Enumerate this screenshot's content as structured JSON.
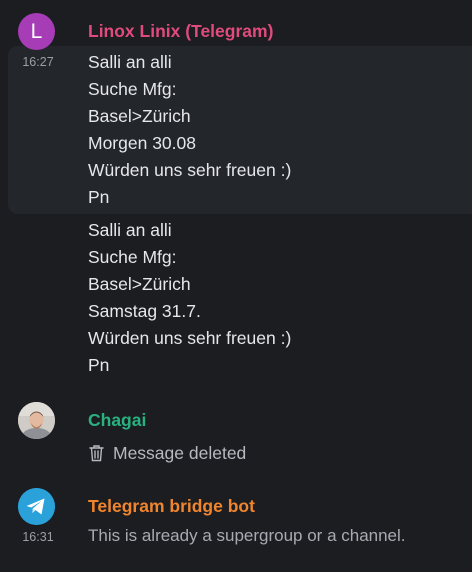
{
  "events": [
    {
      "sender": "Linox Linix (Telegram)",
      "sender_color": "#e14a7d",
      "avatar_letter": "L",
      "avatar_color": "#a63db6",
      "messages": [
        {
          "time": "16:27",
          "lines": [
            "Salli an alli",
            "Suche Mfg:",
            "Basel>Zürich",
            "Morgen 30.08",
            "Würden uns sehr freuen :)",
            "Pn"
          ]
        },
        {
          "lines": [
            "Salli an alli",
            "Suche Mfg:",
            "Basel>Zürich",
            "Samstag 31.7.",
            "Würden uns sehr freuen :)",
            "Pn"
          ]
        }
      ]
    },
    {
      "sender": "Chagai",
      "sender_color": "#29b27f",
      "avatar_icon": "user-photo-icon",
      "deleted_text": "Message deleted",
      "deleted_icon": "trash-icon"
    },
    {
      "sender": "Telegram bridge bot",
      "sender_color": "#f0852d",
      "avatar_icon": "telegram-plane-icon",
      "avatar_color": "#2aa1d9",
      "time": "16:31",
      "notice": "This is already a supergroup or a channel."
    }
  ]
}
